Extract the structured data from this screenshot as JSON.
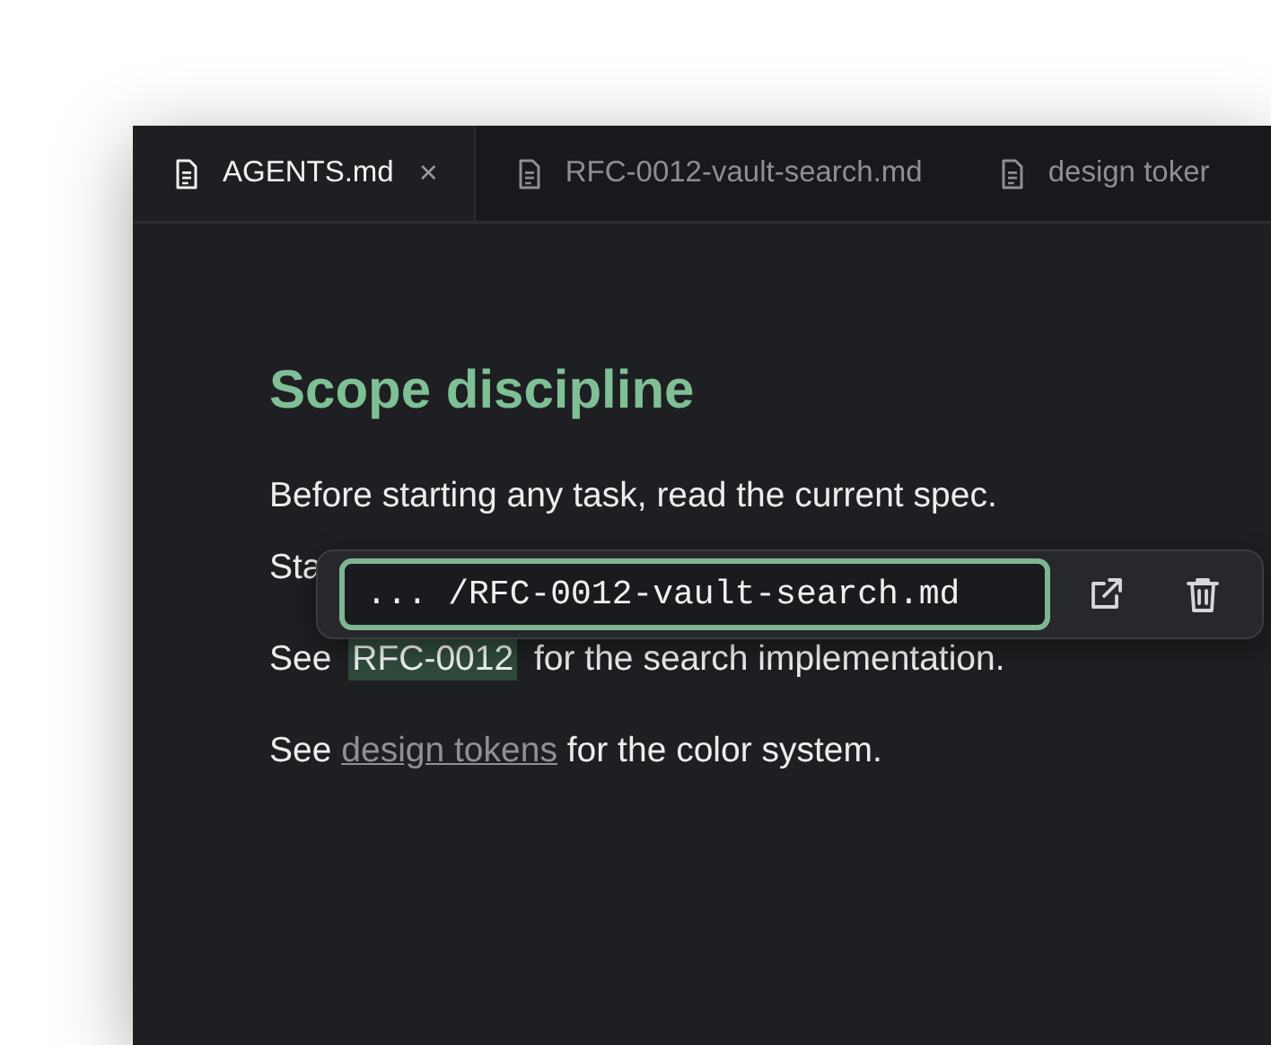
{
  "tabs": [
    {
      "label": "AGENTS.md",
      "selected": true,
      "close": "×"
    },
    {
      "label": "RFC-0012-vault-search.md",
      "selected": false
    },
    {
      "label": "design toker",
      "selected": false
    }
  ],
  "document": {
    "heading": "Scope discipline",
    "lines": [
      [
        {
          "kind": "text",
          "text": "Before starting any task, read the current spec."
        }
      ],
      [
        {
          "kind": "text",
          "text": "Sta"
        }
      ],
      [
        {
          "kind": "text",
          "text": "See "
        },
        {
          "kind": "ref",
          "text": "RFC-0012"
        },
        {
          "kind": "text",
          "text": " for the search implementation."
        }
      ],
      [
        {
          "kind": "text",
          "text": "See "
        },
        {
          "kind": "link",
          "text": "design tokens"
        },
        {
          "kind": "text",
          "text": " for the color system."
        }
      ]
    ]
  },
  "link_popover": {
    "value": "... /RFC-0012-vault-search.md",
    "focused": true
  }
}
